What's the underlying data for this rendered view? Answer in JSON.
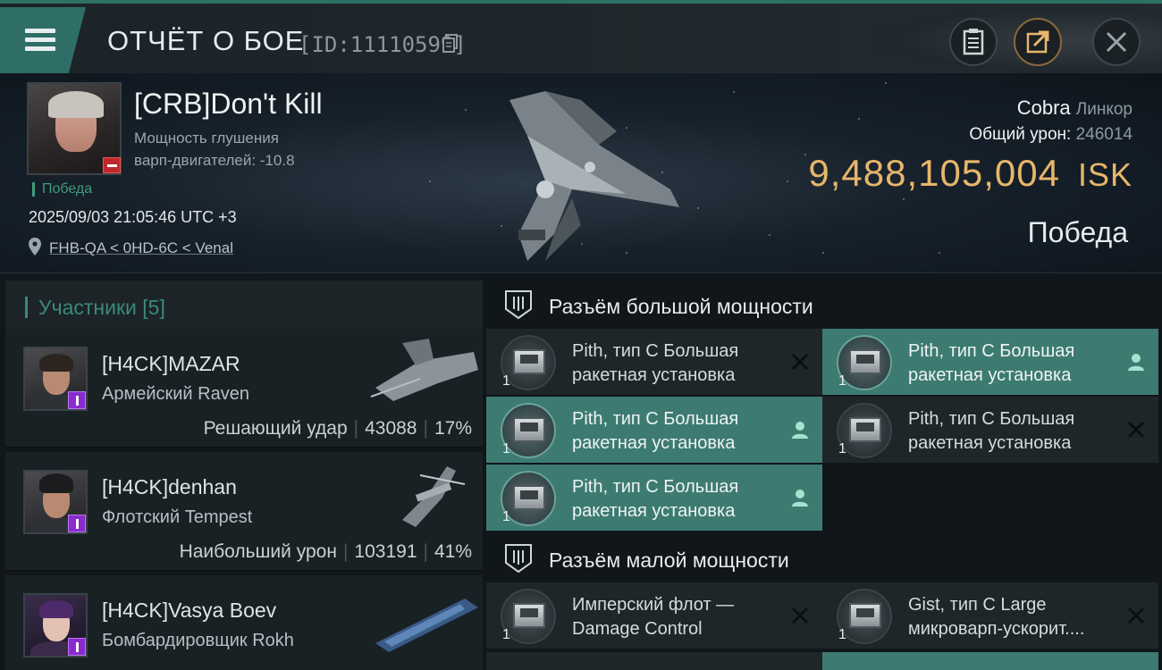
{
  "header": {
    "title": "ОТЧЁТ О БОЕ",
    "report_id": "[ID:11110599]"
  },
  "victim": {
    "name": "[CRB]Don't Kill",
    "stat_line1": "Мощность глушения",
    "stat_line2": "варп-двигателей: -10.8",
    "status": "Победа",
    "datetime": "2025/09/03 21:05:46 UTC +3",
    "location": "FHB-QA < 0HD-6C < Venal",
    "ship_name": "Cobra",
    "ship_class": "Линкор",
    "total_damage_label": "Общий урон:",
    "total_damage": "246014",
    "isk_value": "9,488,105,004",
    "isk_unit": "ISK",
    "result": "Победа"
  },
  "participants": {
    "title": "Участники [5]",
    "rows": [
      {
        "name": "[H4CK]MAZAR",
        "ship": "Армейский Raven",
        "role": "Решающий удар",
        "damage": "43088",
        "percent": "17%"
      },
      {
        "name": "[H4CK]denhan",
        "ship": "Флотский Tempest",
        "role": "Наибольший урон",
        "damage": "103191",
        "percent": "41%"
      },
      {
        "name": "[H4CK]Vasya Boev",
        "ship": "Бомбардировщик Rokh"
      }
    ]
  },
  "fitting": {
    "high_title": "Разъём большой мощности",
    "low_title": "Разъём малой мощности",
    "high_modules": [
      {
        "line1": "Pith, тип C Большая",
        "line2": "ракетная установка",
        "qty": "1",
        "state": "destroyed"
      },
      {
        "line1": "Pith, тип C Большая",
        "line2": "ракетная установка",
        "qty": "1",
        "state": "dropped"
      },
      {
        "line1": "Pith, тип C Большая",
        "line2": "ракетная установка",
        "qty": "1",
        "state": "dropped"
      },
      {
        "line1": "Pith, тип C Большая",
        "line2": "ракетная установка",
        "qty": "1",
        "state": "destroyed"
      },
      {
        "line1": "Pith, тип C Большая",
        "line2": "ракетная установка",
        "qty": "1",
        "state": "dropped"
      }
    ],
    "low_modules": [
      {
        "line1": "Имперский флот —",
        "line2": "Damage Control",
        "qty": "1",
        "state": "destroyed"
      },
      {
        "line1": "Gist, тип C Large",
        "line2": "микроварп-ускорит....",
        "qty": "1",
        "state": "destroyed"
      }
    ]
  },
  "colors": {
    "accent": "#3d7b72",
    "isk": "#e7b66a",
    "victory": "#3f9b7d",
    "badge_purple": "#8a2bd0",
    "badge_red": "#c0282d"
  },
  "icons": [
    "menu-icon",
    "copy-icon",
    "clipboard-icon",
    "share-icon",
    "close-icon",
    "location-pin-icon",
    "slot-high-icon",
    "slot-low-icon",
    "pilot-icon",
    "cross-icon"
  ]
}
